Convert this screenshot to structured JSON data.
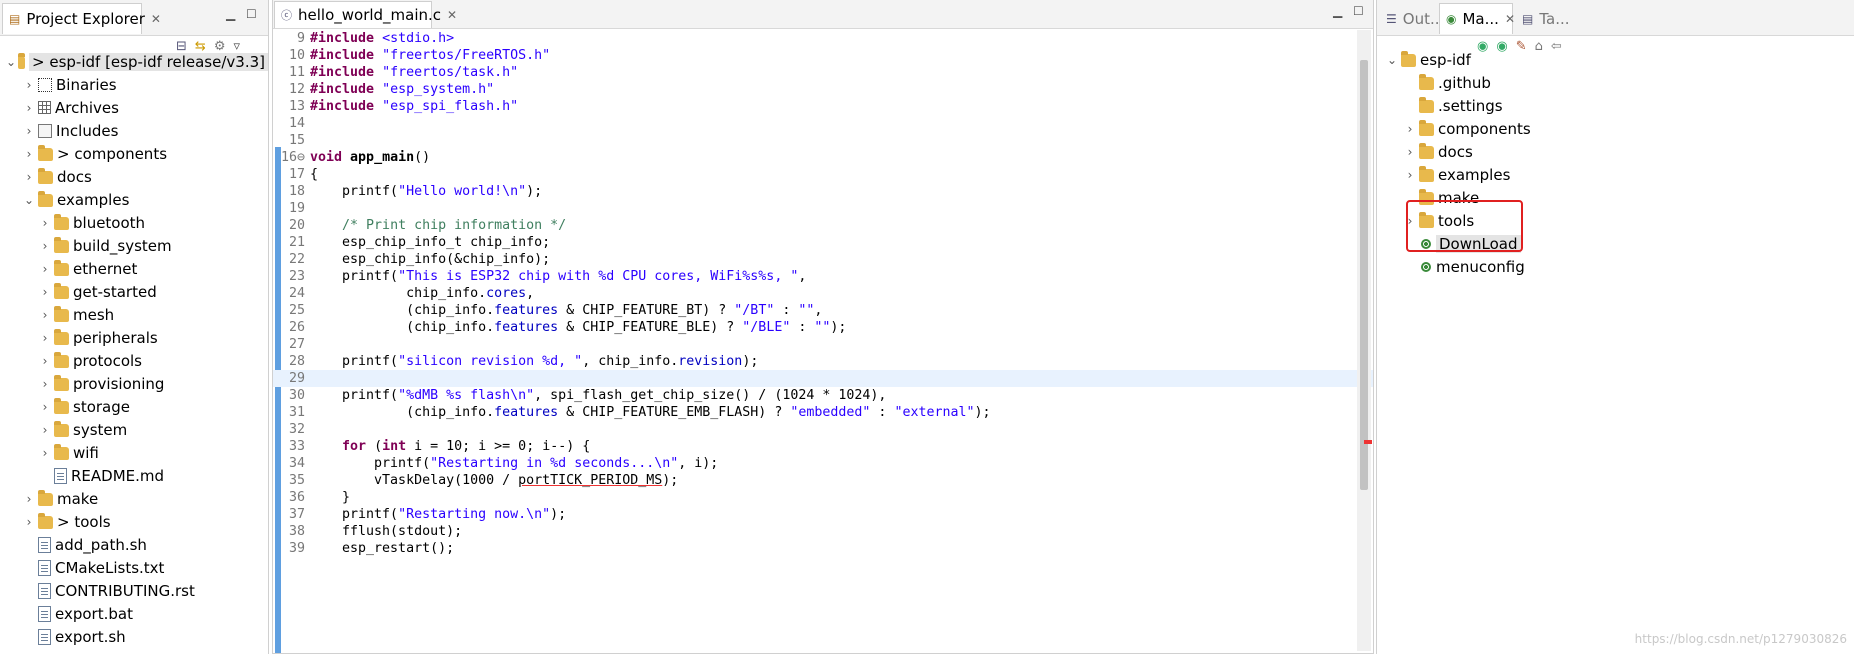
{
  "project_explorer": {
    "tab_label": "Project Explorer",
    "tree": [
      {
        "label": "> esp-idf  [esp-idf release/v3.3]",
        "depth": 0,
        "twisty": "v",
        "icon": "project-icon",
        "selected": true
      },
      {
        "label": "Binaries",
        "depth": 1,
        "twisty": ">",
        "icon": "binaries-icon"
      },
      {
        "label": "Archives",
        "depth": 1,
        "twisty": ">",
        "icon": "archives-icon"
      },
      {
        "label": "Includes",
        "depth": 1,
        "twisty": ">",
        "icon": "includes-icon"
      },
      {
        "label": "> components",
        "depth": 1,
        "twisty": ">",
        "icon": "folder-icon"
      },
      {
        "label": "docs",
        "depth": 1,
        "twisty": ">",
        "icon": "folder-icon"
      },
      {
        "label": "examples",
        "depth": 1,
        "twisty": "v",
        "icon": "folder-icon"
      },
      {
        "label": "bluetooth",
        "depth": 2,
        "twisty": ">",
        "icon": "folder-icon"
      },
      {
        "label": "build_system",
        "depth": 2,
        "twisty": ">",
        "icon": "folder-icon"
      },
      {
        "label": "ethernet",
        "depth": 2,
        "twisty": ">",
        "icon": "folder-icon"
      },
      {
        "label": "get-started",
        "depth": 2,
        "twisty": ">",
        "icon": "folder-icon"
      },
      {
        "label": "mesh",
        "depth": 2,
        "twisty": ">",
        "icon": "folder-icon"
      },
      {
        "label": "peripherals",
        "depth": 2,
        "twisty": ">",
        "icon": "folder-icon"
      },
      {
        "label": "protocols",
        "depth": 2,
        "twisty": ">",
        "icon": "folder-icon"
      },
      {
        "label": "provisioning",
        "depth": 2,
        "twisty": ">",
        "icon": "folder-icon"
      },
      {
        "label": "storage",
        "depth": 2,
        "twisty": ">",
        "icon": "folder-icon"
      },
      {
        "label": "system",
        "depth": 2,
        "twisty": ">",
        "icon": "folder-icon"
      },
      {
        "label": "wifi",
        "depth": 2,
        "twisty": ">",
        "icon": "folder-icon"
      },
      {
        "label": "README.md",
        "depth": 2,
        "twisty": "",
        "icon": "file-icon"
      },
      {
        "label": "make",
        "depth": 1,
        "twisty": ">",
        "icon": "folder-icon"
      },
      {
        "label": "> tools",
        "depth": 1,
        "twisty": ">",
        "icon": "folder-icon"
      },
      {
        "label": "add_path.sh",
        "depth": 1,
        "twisty": "",
        "icon": "file-icon"
      },
      {
        "label": "CMakeLists.txt",
        "depth": 1,
        "twisty": "",
        "icon": "file-icon"
      },
      {
        "label": "CONTRIBUTING.rst",
        "depth": 1,
        "twisty": "",
        "icon": "file-icon"
      },
      {
        "label": "export.bat",
        "depth": 1,
        "twisty": "",
        "icon": "file-icon"
      },
      {
        "label": "export.sh",
        "depth": 1,
        "twisty": "",
        "icon": "file-icon"
      }
    ]
  },
  "editor": {
    "tab_label": "hello_world_main.c",
    "lines": [
      {
        "n": "9",
        "html": "<span class='kw'>#include</span> <span class='str'>&lt;stdio.h&gt;</span>"
      },
      {
        "n": "10",
        "html": "<span class='kw'>#include</span> <span class='str'>\"freertos/FreeRTOS.h\"</span>"
      },
      {
        "n": "11",
        "html": "<span class='kw'>#include</span> <span class='str'>\"freertos/task.h\"</span>"
      },
      {
        "n": "12",
        "html": "<span class='kw'>#include</span> <span class='str'>\"esp_system.h\"</span>"
      },
      {
        "n": "13",
        "html": "<span class='kw'>#include</span> <span class='str'>\"esp_spi_flash.h\"</span>"
      },
      {
        "n": "14",
        "html": ""
      },
      {
        "n": "15",
        "html": ""
      },
      {
        "n": "16⊖",
        "html": "<span class='kw'>void</span> <b>app_main</b>()"
      },
      {
        "n": "17",
        "html": "{"
      },
      {
        "n": "18",
        "html": "    printf(<span class='str'>\"Hello world!\\n\"</span>);"
      },
      {
        "n": "19",
        "html": ""
      },
      {
        "n": "20",
        "html": "    <span class='com'>/* Print chip information */</span>"
      },
      {
        "n": "21",
        "html": "    esp_chip_info_t chip_info;"
      },
      {
        "n": "22",
        "html": "    esp_chip_info(&amp;chip_info);"
      },
      {
        "n": "23",
        "html": "    printf(<span class='str'>\"This is ESP32 chip with %d CPU cores, WiFi%s%s, \"</span>,"
      },
      {
        "n": "24",
        "html": "            chip_info.<span class='fld'>cores</span>,"
      },
      {
        "n": "25",
        "html": "            (chip_info.<span class='fld'>features</span> &amp; CHIP_FEATURE_BT) ? <span class='str'>\"/BT\"</span> : <span class='str'>\"\"</span>,"
      },
      {
        "n": "26",
        "html": "            (chip_info.<span class='fld'>features</span> &amp; CHIP_FEATURE_BLE) ? <span class='str'>\"/BLE\"</span> : <span class='str'>\"\"</span>);"
      },
      {
        "n": "27",
        "html": ""
      },
      {
        "n": "28",
        "html": "    printf(<span class='str'>\"silicon revision %d, \"</span>, chip_info.<span class='fld'>revision</span>);"
      },
      {
        "n": "29",
        "html": "",
        "current": true
      },
      {
        "n": "30",
        "html": "    printf(<span class='str'>\"%dMB %s flash\\n\"</span>, spi_flash_get_chip_size() / (1024 * 1024),"
      },
      {
        "n": "31",
        "html": "            (chip_info.<span class='fld'>features</span> &amp; CHIP_FEATURE_EMB_FLASH) ? <span class='str'>\"embedded\"</span> : <span class='str'>\"external\"</span>);"
      },
      {
        "n": "32",
        "html": ""
      },
      {
        "n": "33",
        "html": "    <span class='kw'>for</span> (<span class='kw'>int</span> i = 10; i &gt;= 0; i--) {"
      },
      {
        "n": "34",
        "html": "        printf(<span class='str'>\"Restarting in %d seconds...\\n\"</span>, i);"
      },
      {
        "n": "35",
        "html": "        vTaskDelay(1000 / <u style='text-decoration-color:#e33'>portTICK_PERIOD_MS</u>);"
      },
      {
        "n": "36",
        "html": "    }"
      },
      {
        "n": "37",
        "html": "    printf(<span class='str'>\"Restarting now.\\n\"</span>);"
      },
      {
        "n": "38",
        "html": "    fflush(stdout);"
      },
      {
        "n": "39",
        "html": "    esp_restart();"
      }
    ]
  },
  "right_panel": {
    "tabs": [
      {
        "label": "Out...",
        "icon": "outline-icon",
        "active": false
      },
      {
        "label": "Ma...",
        "icon": "make-target-icon",
        "active": true
      },
      {
        "label": "Ta...",
        "icon": "task-list-icon",
        "active": false
      }
    ],
    "tree": [
      {
        "label": "esp-idf",
        "depth": 0,
        "twisty": "v",
        "icon": "project-icon"
      },
      {
        "label": ".github",
        "depth": 1,
        "twisty": "",
        "icon": "folder-icon"
      },
      {
        "label": ".settings",
        "depth": 1,
        "twisty": "",
        "icon": "folder-icon"
      },
      {
        "label": "components",
        "depth": 1,
        "twisty": ">",
        "icon": "folder-icon"
      },
      {
        "label": "docs",
        "depth": 1,
        "twisty": ">",
        "icon": "folder-icon"
      },
      {
        "label": "examples",
        "depth": 1,
        "twisty": ">",
        "icon": "folder-icon"
      },
      {
        "label": "make",
        "depth": 1,
        "twisty": "",
        "icon": "folder-icon"
      },
      {
        "label": "tools",
        "depth": 1,
        "twisty": ">",
        "icon": "folder-icon"
      },
      {
        "label": "DownLoad",
        "depth": 1,
        "twisty": "",
        "icon": "target-icon",
        "selected": true
      },
      {
        "label": "menuconfig",
        "depth": 1,
        "twisty": "",
        "icon": "target-icon"
      }
    ]
  },
  "watermark": "https://blog.csdn.net/p1279030826",
  "colors": {
    "highlight_box": "#e02020",
    "current_line": "#e8f2fe",
    "change_bar": "#5f9fe0"
  }
}
